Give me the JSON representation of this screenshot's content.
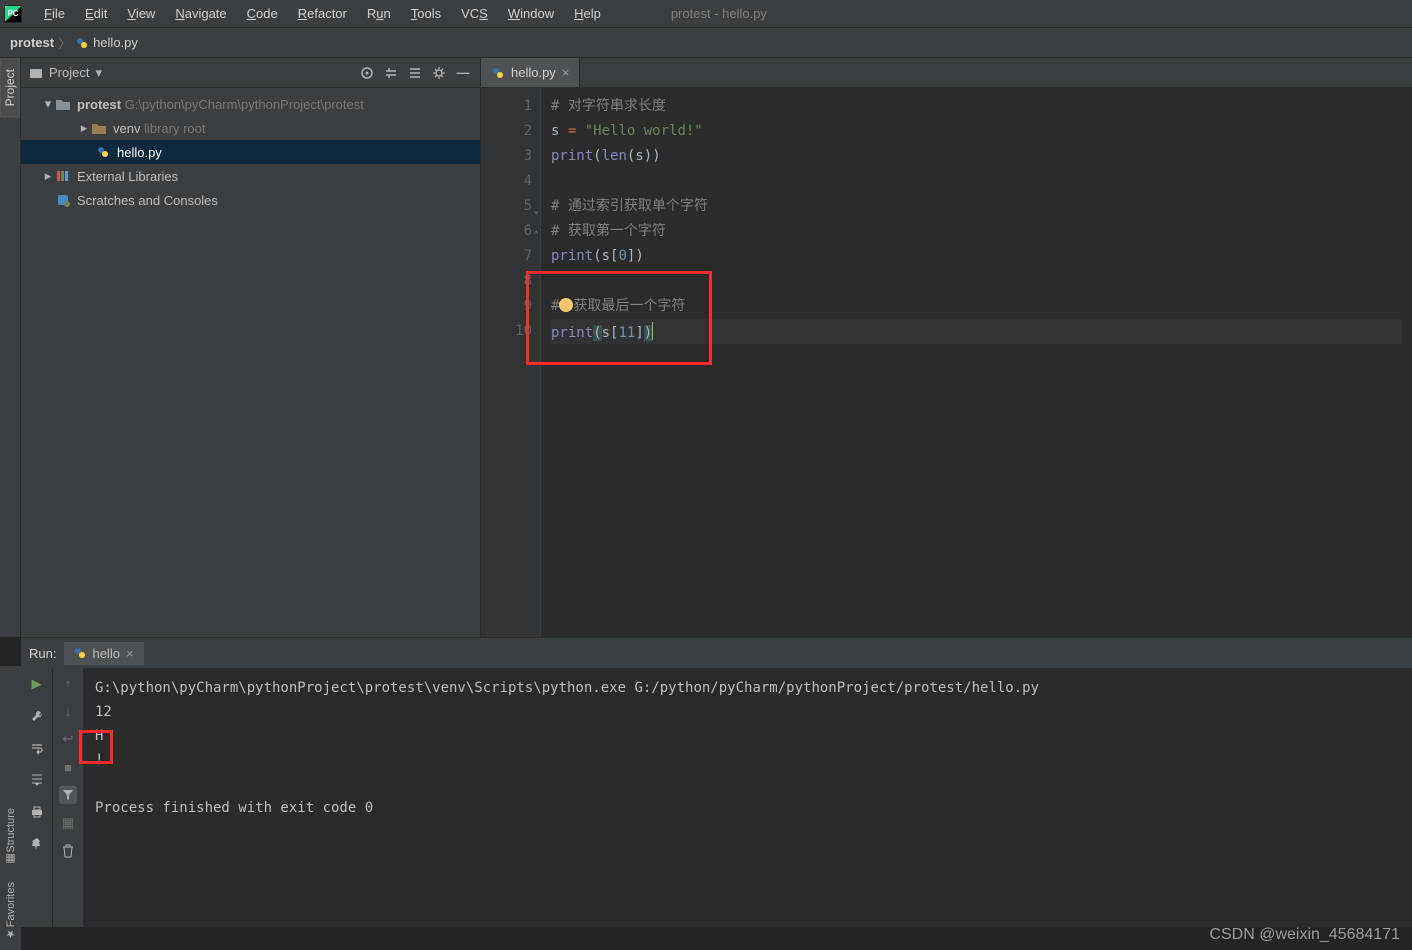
{
  "menubar": {
    "items": [
      {
        "u": "F",
        "rest": "ile"
      },
      {
        "u": "E",
        "rest": "dit"
      },
      {
        "u": "V",
        "rest": "iew"
      },
      {
        "u": "N",
        "rest": "avigate"
      },
      {
        "u": "C",
        "rest": "ode"
      },
      {
        "u": "R",
        "rest": "efactor"
      },
      {
        "u": "",
        "rest": "R",
        "u2": "u",
        "rest2": "n"
      },
      {
        "u": "T",
        "rest": "ools"
      },
      {
        "u": "",
        "rest": "VC",
        "u2": "S",
        "rest2": ""
      },
      {
        "u": "W",
        "rest": "indow"
      },
      {
        "u": "H",
        "rest": "elp"
      }
    ],
    "window_title": "protest - hello.py"
  },
  "breadcrumbs": {
    "root": "protest",
    "file": "hello.py"
  },
  "project_panel": {
    "title": "Project",
    "tree": {
      "root": {
        "name": "protest",
        "path": "G:\\python\\pyCharm\\pythonProject\\protest"
      },
      "venv": {
        "name": "venv",
        "hint": "library root"
      },
      "file": {
        "name": "hello.py"
      },
      "ext": {
        "name": "External Libraries"
      },
      "scratch": {
        "name": "Scratches and Consoles"
      }
    }
  },
  "editor": {
    "tab": "hello.py",
    "gutter": [
      "1",
      "2",
      "3",
      "4",
      "5",
      "6",
      "7",
      "8",
      "9",
      "10"
    ],
    "code": {
      "l1": "#  对字符串求长度",
      "l2_a": "s ",
      "l2_b": "=",
      "l2_c": " \"Hello world!\"",
      "l3_a": "print",
      "l3_b": "(",
      "l3_c": "len",
      "l3_d": "(",
      "l3_e": "s",
      "l3_f": "))",
      "l5_mark": "",
      "l5": "#  通过索引获取单个字符",
      "l6": "#  获取第一个字符",
      "l7_a": "print",
      "l7_b": "(",
      "l7_c": "s",
      "l7_d": "[",
      "l7_e": "0",
      "l7_f": "])",
      "l9_a": "#",
      "l9_b": "获取最后一个字符",
      "l10_a": "print",
      "l10_b": "(",
      "l10_c": "s",
      "l10_d": "[",
      "l10_e": "11",
      "l10_f": "]",
      "l10_g": ")"
    }
  },
  "run": {
    "label": "Run:",
    "tab": "hello",
    "out": {
      "cmd": "G:\\python\\pyCharm\\pythonProject\\protest\\venv\\Scripts\\python.exe G:/python/pyCharm/pythonProject/protest/hello.py",
      "l1": "12",
      "l2": "H",
      "l3": "!",
      "exit": "Process finished with exit code 0"
    }
  },
  "left_tabs": {
    "project": "Project",
    "structure": "Structure",
    "favorites": "Favorites"
  },
  "watermark": "CSDN @weixin_45684171"
}
